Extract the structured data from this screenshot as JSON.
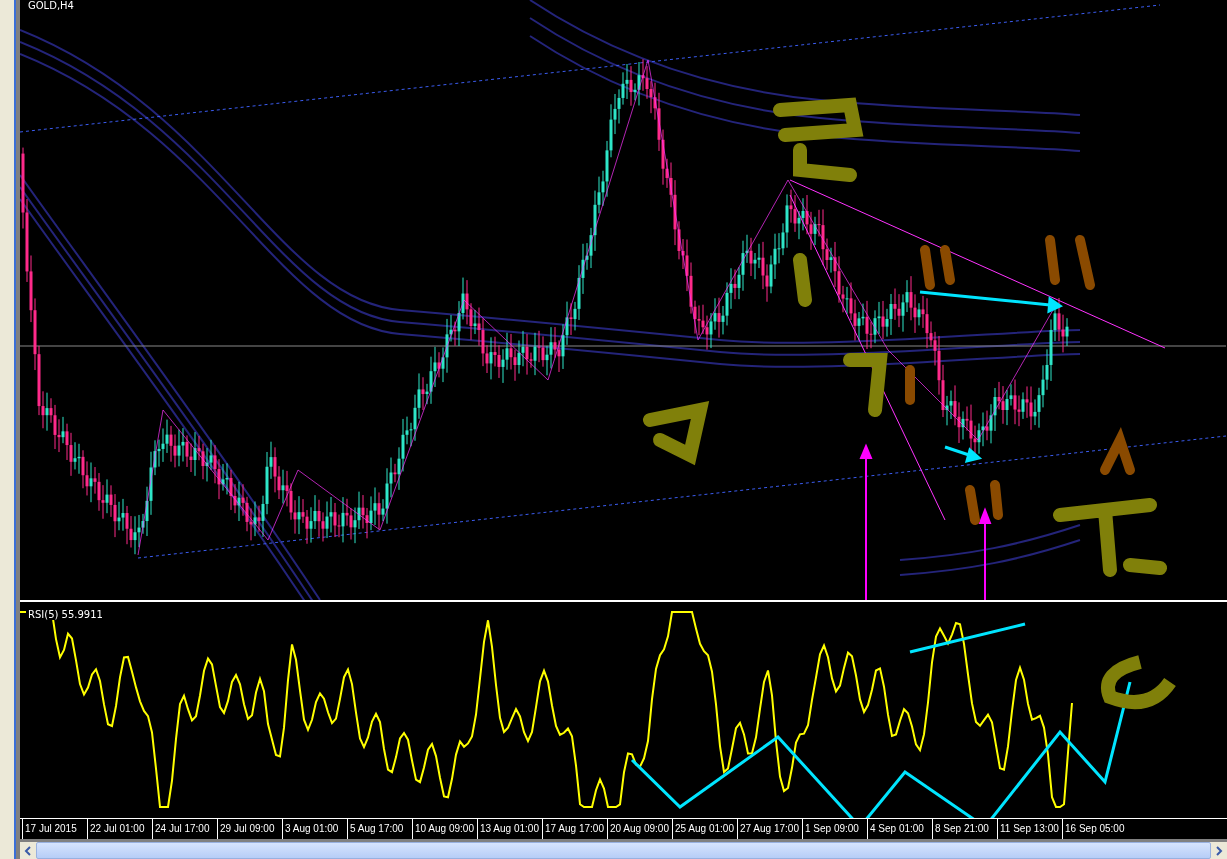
{
  "chart": {
    "title": "GOLD,H4"
  },
  "indicator": {
    "label": "RSI(5) 55.9911"
  },
  "time_axis": {
    "labels": [
      "17 Jul 2015",
      "22 Jul 01:00",
      "24 Jul 17:00",
      "29 Jul 09:00",
      "3 Aug 01:00",
      "5 Aug 17:00",
      "10 Aug 09:00",
      "13 Aug 01:00",
      "17 Aug 17:00",
      "20 Aug 09:00",
      "25 Aug 01:00",
      "27 Aug 17:00",
      "1 Sep 09:00",
      "4 Sep 01:00",
      "8 Sep 21:00",
      "11 Sep 13:00",
      "16 Sep 05:00"
    ]
  }
}
